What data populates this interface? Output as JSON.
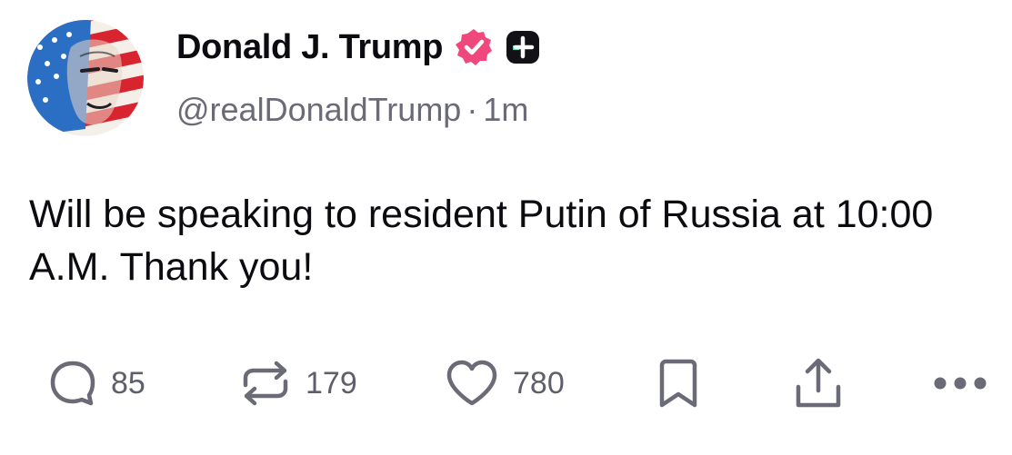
{
  "author": {
    "display_name": "Donald J. Trump",
    "handle": "@realDonaldTrump",
    "separator": "·",
    "timestamp": "1m",
    "verified_badge_color": "#f0487d",
    "avatar_icon": "profile-avatar"
  },
  "post": {
    "text": "Will be speaking to resident Putin of Russia at 10:00 A.M. Thank you!"
  },
  "actions": {
    "reply_count": "85",
    "repost_count": "179",
    "like_count": "780",
    "icons": [
      "reply-icon",
      "repost-icon",
      "like-icon",
      "bookmark-icon",
      "share-icon",
      "more-icon"
    ],
    "icon_color": "#6b6b78"
  }
}
